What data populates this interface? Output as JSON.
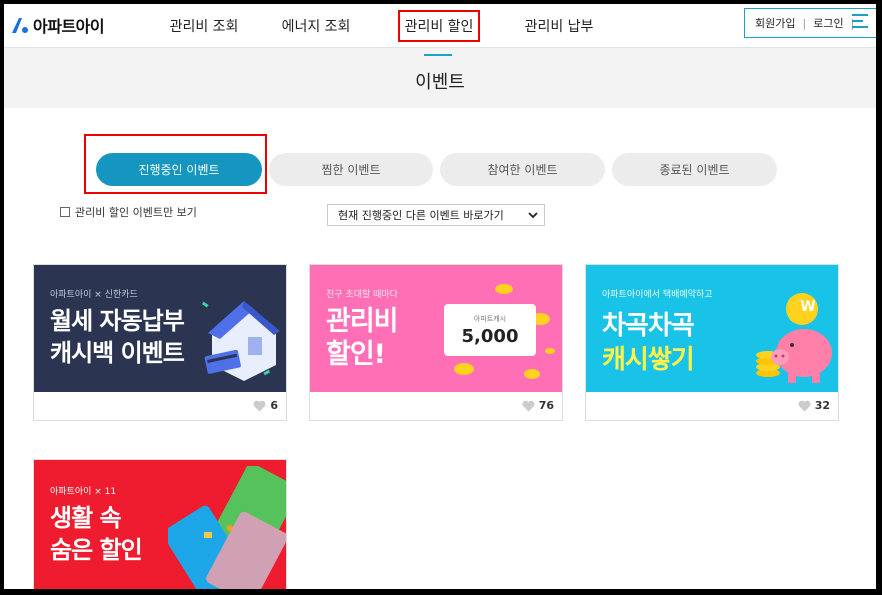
{
  "brand": {
    "name": "아파트아이",
    "accent": "#1ba0c6",
    "logo_dot": "#1a6fe0"
  },
  "nav": {
    "items": [
      {
        "label": "관리비 조회"
      },
      {
        "label": "에너지 조회"
      },
      {
        "label": "관리비 할인",
        "highlighted": true
      },
      {
        "label": "관리비 납부"
      }
    ],
    "signup": "회원가입",
    "login": "로그인",
    "menu_icon": "hamburger-menu-icon"
  },
  "page": {
    "title": "이벤트"
  },
  "tabs": [
    {
      "label": "진행중인 이벤트",
      "active": true
    },
    {
      "label": "찜한 이벤트"
    },
    {
      "label": "참여한 이벤트"
    },
    {
      "label": "종료된 이벤트"
    }
  ],
  "filter": {
    "checkbox_label": "관리비 할인 이벤트만 보기",
    "checked": false
  },
  "quick_select": {
    "value": "현재 진행중인 다른 이벤트 바로가기"
  },
  "events": [
    {
      "small": "아파트아이 × 신한카드",
      "big": "월세 자동납부\n캐시백 이벤트",
      "likes": "6",
      "bg": "#2b3552"
    },
    {
      "small": "친구 초대할 때마다",
      "big": "관리비\n할인!",
      "amount_caption": "아파트캐시",
      "amount": "5,000",
      "likes": "76",
      "bg": "#ff6fb5"
    },
    {
      "small": "아파트아이에서 택배예약하고",
      "big_line1": "차곡차곡",
      "big_line2": "캐시쌓기",
      "coin": "W",
      "likes": "32",
      "bg": "#19c3e8"
    },
    {
      "small": "아파트아이 × 11",
      "big": "생활 속\n숨은 할인",
      "bg": "#ee1c2e"
    }
  ]
}
